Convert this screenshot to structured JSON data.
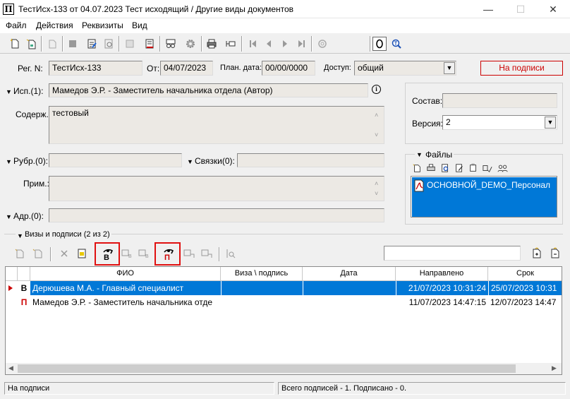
{
  "window": {
    "title": "ТестИсх-133 от 04.07.2023 Тест исходящий / Другие виды документов",
    "app_icon_glyph": "П",
    "minimize_glyph": "—",
    "maximize_glyph": "☐",
    "close_glyph": "✕"
  },
  "menu": [
    "Файл",
    "Действия",
    "Реквизиты",
    "Вид"
  ],
  "form": {
    "reg_label": "Рег. N:",
    "reg_value": "ТестИсх-133",
    "from_label": "От:",
    "from_value": "04/07/2023",
    "plan_label": "План. дата:",
    "plan_value": "00/00/0000",
    "access_label": "Доступ:",
    "access_value": "общий",
    "status_button": "На подписи",
    "isp_label": "Исп.(1):",
    "isp_value": "Мамедов Э.Р. - Заместитель начальника отдела (Автор)",
    "content_label": "Содерж.:",
    "content_value": "тестовый",
    "rubr_label": "Рубр.(0):",
    "links_label": "Связки(0):",
    "note_label": "Прим.:",
    "addr_label": "Адр.(0):",
    "sostav_label": "Состав:",
    "version_label": "Версия:",
    "version_value": "2",
    "files_label": "Файлы",
    "file_name": "ОСНОВНОЙ_DEMO_Персонал"
  },
  "visas": {
    "header": "Визы и подписи (2 из 2)",
    "visa_icon_letter": "В",
    "sign_icon_letter": "П",
    "columns": [
      "ФИО",
      "Виза \\ подпись",
      "Дата",
      "Направлено",
      "Срок"
    ],
    "rows": [
      {
        "type": "В",
        "fio": "Дерюшева М.А. - Главный специалист",
        "visa": "",
        "date": "",
        "sent": "21/07/2023 10:31:24",
        "due": "25/07/2023 10:31",
        "selected": true
      },
      {
        "type": "П",
        "fio": "Мамедов Э.Р. - Заместитель начальника отде",
        "visa": "",
        "date": "",
        "sent": "11/07/2023 14:47:15",
        "due": "12/07/2023 14:47",
        "selected": false
      }
    ]
  },
  "statusbar": {
    "left": "На подписи",
    "right": "Всего подписей - 1.  Подписано - 0."
  },
  "colors": {
    "selection": "#0078d7",
    "status_red": "#cc0000",
    "sign_letter": "#cc0000"
  }
}
